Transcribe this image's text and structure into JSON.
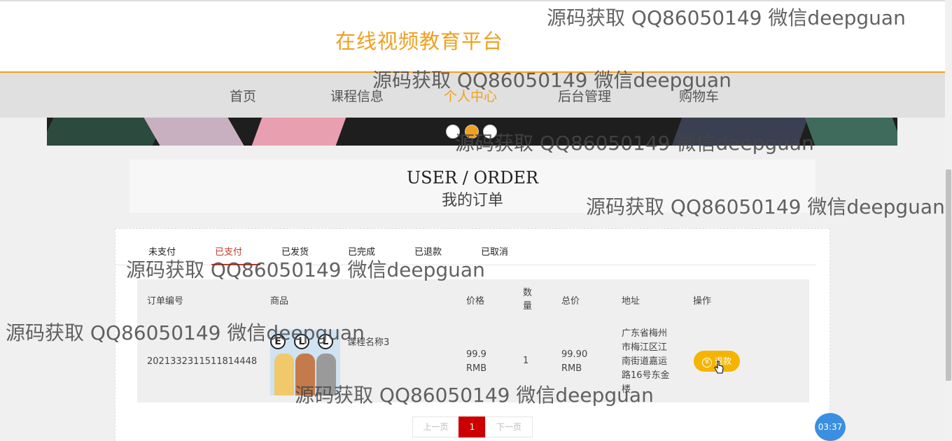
{
  "header": {
    "site_title": "在线视频教育平台"
  },
  "nav": {
    "items": [
      "首页",
      "课程信息",
      "个人中心",
      "后台管理",
      "购物车"
    ],
    "active_index": 2
  },
  "page_heading": {
    "en": "USER / ORDER",
    "cn": "我的订单"
  },
  "order_tabs": {
    "items": [
      "未支付",
      "已支付",
      "已发货",
      "已完成",
      "已退款",
      "已取消"
    ],
    "active_index": 1
  },
  "table": {
    "headers": {
      "order_no": "订单编号",
      "product": "商品",
      "price": "价格",
      "qty_line1": "数",
      "qty_line2": "量",
      "total": "总价",
      "address": "地址",
      "action": "操作"
    },
    "rows": [
      {
        "order_no": "2021332311511814448",
        "product_name": "课程名称3",
        "price_value": "99.9",
        "price_unit": "RMB",
        "qty": "1",
        "total_value": "99.90",
        "total_unit": "RMB",
        "address": [
          "广东省梅州",
          "市梅江区江",
          "南街道嘉运",
          "路16号东金",
          "楼"
        ],
        "action_label": "退款",
        "image_letters": [
          "E",
          "L",
          "L"
        ]
      }
    ]
  },
  "pagination": {
    "prev": "上一页",
    "current": "1",
    "next": "下一页"
  },
  "timer": "03:37",
  "watermark": "源码获取 QQ86050149 微信deepguan",
  "colors": {
    "accent": "#f0a020",
    "active_tab": "#c0392b",
    "pager_current": "#cc0000",
    "refund_button": "#f5b400"
  }
}
